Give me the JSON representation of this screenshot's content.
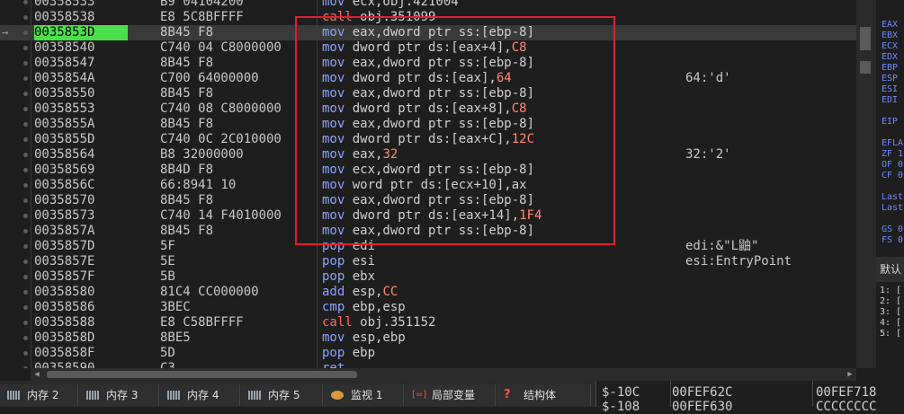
{
  "disasm": {
    "rows": [
      {
        "addr": "00358533",
        "bytes": "B9 04104200",
        "asm": [
          [
            "kw-mov",
            "mov "
          ],
          [
            "",
            "ecx,obj.421004"
          ]
        ],
        "cmt": ""
      },
      {
        "addr": "00358538",
        "bytes": "E8 5C8BFFFF",
        "asm": [
          [
            "kw-call",
            "call "
          ],
          [
            "",
            "obj.351099"
          ]
        ],
        "cmt": ""
      },
      {
        "addr": "0035853D",
        "bytes": "8B45 F8",
        "asm": [
          [
            "kw-mov",
            "mov "
          ],
          [
            "",
            "eax,dword ptr ss:[ebp-8]"
          ]
        ],
        "cmt": "",
        "current": true
      },
      {
        "addr": "00358540",
        "bytes": "C740 04 C8000000",
        "asm": [
          [
            "kw-mov",
            "mov "
          ],
          [
            "",
            "dword ptr ds:[eax+4],"
          ],
          [
            "imm",
            "C8"
          ]
        ],
        "cmt": ""
      },
      {
        "addr": "00358547",
        "bytes": "8B45 F8",
        "asm": [
          [
            "kw-mov",
            "mov "
          ],
          [
            "",
            "eax,dword ptr ss:[ebp-8]"
          ]
        ],
        "cmt": ""
      },
      {
        "addr": "0035854A",
        "bytes": "C700 64000000",
        "asm": [
          [
            "kw-mov",
            "mov "
          ],
          [
            "",
            "dword ptr ds:[eax],"
          ],
          [
            "imm",
            "64"
          ]
        ],
        "cmt": "64:'d'"
      },
      {
        "addr": "00358550",
        "bytes": "8B45 F8",
        "asm": [
          [
            "kw-mov",
            "mov "
          ],
          [
            "",
            "eax,dword ptr ss:[ebp-8]"
          ]
        ],
        "cmt": ""
      },
      {
        "addr": "00358553",
        "bytes": "C740 08 C8000000",
        "asm": [
          [
            "kw-mov",
            "mov "
          ],
          [
            "",
            "dword ptr ds:[eax+8],"
          ],
          [
            "imm",
            "C8"
          ]
        ],
        "cmt": ""
      },
      {
        "addr": "0035855A",
        "bytes": "8B45 F8",
        "asm": [
          [
            "kw-mov",
            "mov "
          ],
          [
            "",
            "eax,dword ptr ss:[ebp-8]"
          ]
        ],
        "cmt": ""
      },
      {
        "addr": "0035855D",
        "bytes": "C740 0C 2C010000",
        "asm": [
          [
            "kw-mov",
            "mov "
          ],
          [
            "",
            "dword ptr ds:[eax+C],"
          ],
          [
            "imm",
            "12C"
          ]
        ],
        "cmt": ""
      },
      {
        "addr": "00358564",
        "bytes": "B8 32000000",
        "asm": [
          [
            "kw-mov",
            "mov "
          ],
          [
            "",
            "eax,"
          ],
          [
            "imm",
            "32"
          ]
        ],
        "cmt": "32:'2'"
      },
      {
        "addr": "00358569",
        "bytes": "8B4D F8",
        "asm": [
          [
            "kw-mov",
            "mov "
          ],
          [
            "",
            "ecx,dword ptr ss:[ebp-8]"
          ]
        ],
        "cmt": ""
      },
      {
        "addr": "0035856C",
        "bytes": "66:8941 10",
        "asm": [
          [
            "kw-mov",
            "mov "
          ],
          [
            "",
            "word ptr ds:[ecx+10],ax"
          ]
        ],
        "cmt": ""
      },
      {
        "addr": "00358570",
        "bytes": "8B45 F8",
        "asm": [
          [
            "kw-mov",
            "mov "
          ],
          [
            "",
            "eax,dword ptr ss:[ebp-8]"
          ]
        ],
        "cmt": ""
      },
      {
        "addr": "00358573",
        "bytes": "C740 14 F4010000",
        "asm": [
          [
            "kw-mov",
            "mov "
          ],
          [
            "",
            "dword ptr ds:[eax+14],"
          ],
          [
            "imm",
            "1F4"
          ]
        ],
        "cmt": ""
      },
      {
        "addr": "0035857A",
        "bytes": "8B45 F8",
        "asm": [
          [
            "kw-mov",
            "mov "
          ],
          [
            "",
            "eax,dword ptr ss:[ebp-8]"
          ]
        ],
        "cmt": ""
      },
      {
        "addr": "0035857D",
        "bytes": "5F",
        "asm": [
          [
            "kw-push",
            "pop "
          ],
          [
            "",
            "edi"
          ]
        ],
        "cmt": "edi:&\"L鼬\""
      },
      {
        "addr": "0035857E",
        "bytes": "5E",
        "asm": [
          [
            "kw-push",
            "pop "
          ],
          [
            "",
            "esi"
          ]
        ],
        "cmt": "esi:EntryPoint"
      },
      {
        "addr": "0035857F",
        "bytes": "5B",
        "asm": [
          [
            "kw-push",
            "pop "
          ],
          [
            "",
            "ebx"
          ]
        ],
        "cmt": ""
      },
      {
        "addr": "00358580",
        "bytes": "81C4 CC000000",
        "asm": [
          [
            "kw-add",
            "add "
          ],
          [
            "",
            "esp,"
          ],
          [
            "imm",
            "CC"
          ]
        ],
        "cmt": ""
      },
      {
        "addr": "00358586",
        "bytes": "3BEC",
        "asm": [
          [
            "kw-add",
            "cmp "
          ],
          [
            "",
            "ebp,esp"
          ]
        ],
        "cmt": ""
      },
      {
        "addr": "00358588",
        "bytes": "E8 C58BFFFF",
        "asm": [
          [
            "kw-call",
            "call "
          ],
          [
            "",
            "obj.351152"
          ]
        ],
        "cmt": ""
      },
      {
        "addr": "0035858D",
        "bytes": "8BE5",
        "asm": [
          [
            "kw-mov",
            "mov "
          ],
          [
            "",
            "esp,ebp"
          ]
        ],
        "cmt": ""
      },
      {
        "addr": "0035858F",
        "bytes": "5D",
        "asm": [
          [
            "kw-push",
            "pop "
          ],
          [
            "",
            "ebp"
          ]
        ],
        "cmt": ""
      },
      {
        "addr": "00358590",
        "bytes": "C3",
        "asm": [
          [
            "kw-push",
            "ret"
          ]
        ],
        "cmt": ""
      }
    ]
  },
  "registers": [
    "EAX",
    "EBX",
    "ECX",
    "EDX",
    "EBP",
    "ESP",
    "ESI",
    "EDI",
    "",
    "EIP",
    "",
    "EFLA",
    "ZF 1",
    "OF 0",
    "CF 0",
    "",
    "Last",
    "Last",
    "",
    "GS 0",
    "FS 0"
  ],
  "reg_panel": {
    "title": "默认"
  },
  "stack_args": [
    "1: [",
    "2: [",
    "3: [",
    "4: [",
    "5: ["
  ],
  "tabs": [
    {
      "label": "内存 2",
      "icon": "memory-icon"
    },
    {
      "label": "内存 3",
      "icon": "memory-icon"
    },
    {
      "label": "内存 4",
      "icon": "memory-icon"
    },
    {
      "label": "内存 5",
      "icon": "memory-icon"
    },
    {
      "label": "监视 1",
      "icon": "watch-icon"
    },
    {
      "label": "局部变量",
      "icon": "local-vars-icon"
    },
    {
      "label": "结构体",
      "icon": "struct-icon"
    }
  ],
  "stack": {
    "rows": [
      {
        "offset": "$-10C",
        "addr": "00FEF62C",
        "value": "00FEF718"
      },
      {
        "offset": "$-108",
        "addr": "00FEF630",
        "value": "CCCCCCCC"
      }
    ]
  }
}
